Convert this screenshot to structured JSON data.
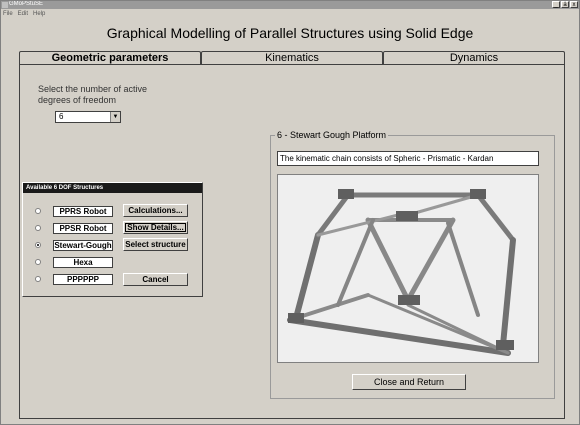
{
  "window": {
    "title": "GMoPStuSE",
    "controls": [
      "_",
      "ȧ",
      "x"
    ]
  },
  "menu": [
    "File",
    "Edit",
    "Help"
  ],
  "app_title": "Graphical Modelling of Parallel Structures using Solid Edge",
  "tabs": [
    {
      "label": "Geometric parameters",
      "active": true
    },
    {
      "label": "Kinematics",
      "active": false
    },
    {
      "label": "Dynamics",
      "active": false
    }
  ],
  "dof": {
    "label": "Select the number of active degrees of freedom",
    "value": "6"
  },
  "structures_window": {
    "title": "Available 6 DOF Structures",
    "options": [
      {
        "label": "PPRS Robot",
        "checked": false
      },
      {
        "label": "PPSR Robot",
        "checked": false
      },
      {
        "label": "Stewart-Gough",
        "checked": true
      },
      {
        "label": "Hexa",
        "checked": false
      },
      {
        "label": "PPPPPP",
        "checked": false
      }
    ],
    "buttons": {
      "calculations": "Calculations...",
      "show_details": "Show Details...",
      "select_structure": "Select structure",
      "cancel": "Cancel"
    }
  },
  "details": {
    "title": "6 - Stewart Gough Platform",
    "description": "The kinematic chain consists of Spheric - Prismatic - Kardan",
    "close_button": "Close and Return"
  },
  "colors": {
    "background": "#d4d0c8",
    "titlebar": "#9a9a9a",
    "subwindow_titlebar": "#1a1a1a",
    "machine": "#7d7d7d"
  }
}
